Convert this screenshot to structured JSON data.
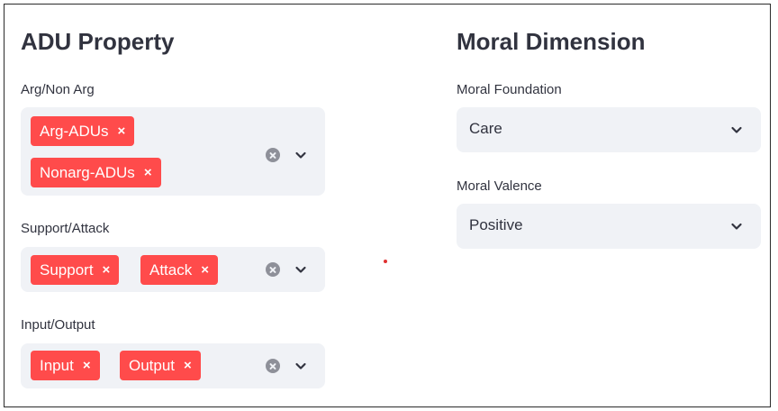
{
  "adu_property": {
    "heading": "ADU Property",
    "arg_nonarg": {
      "label": "Arg/Non Arg",
      "tags": [
        "Arg-ADUs",
        "Nonarg-ADUs"
      ]
    },
    "support_attack": {
      "label": "Support/Attack",
      "tags": [
        "Support",
        "Attack"
      ]
    },
    "input_output": {
      "label": "Input/Output",
      "tags": [
        "Input",
        "Output"
      ]
    }
  },
  "moral_dimension": {
    "heading": "Moral Dimension",
    "moral_foundation": {
      "label": "Moral Foundation",
      "value": "Care"
    },
    "moral_valence": {
      "label": "Moral Valence",
      "value": "Positive"
    }
  },
  "tag_remove_glyph": "×",
  "colors": {
    "tag": "#ff4b4b",
    "select_bg": "#f0f2f6",
    "text": "#31333f"
  }
}
